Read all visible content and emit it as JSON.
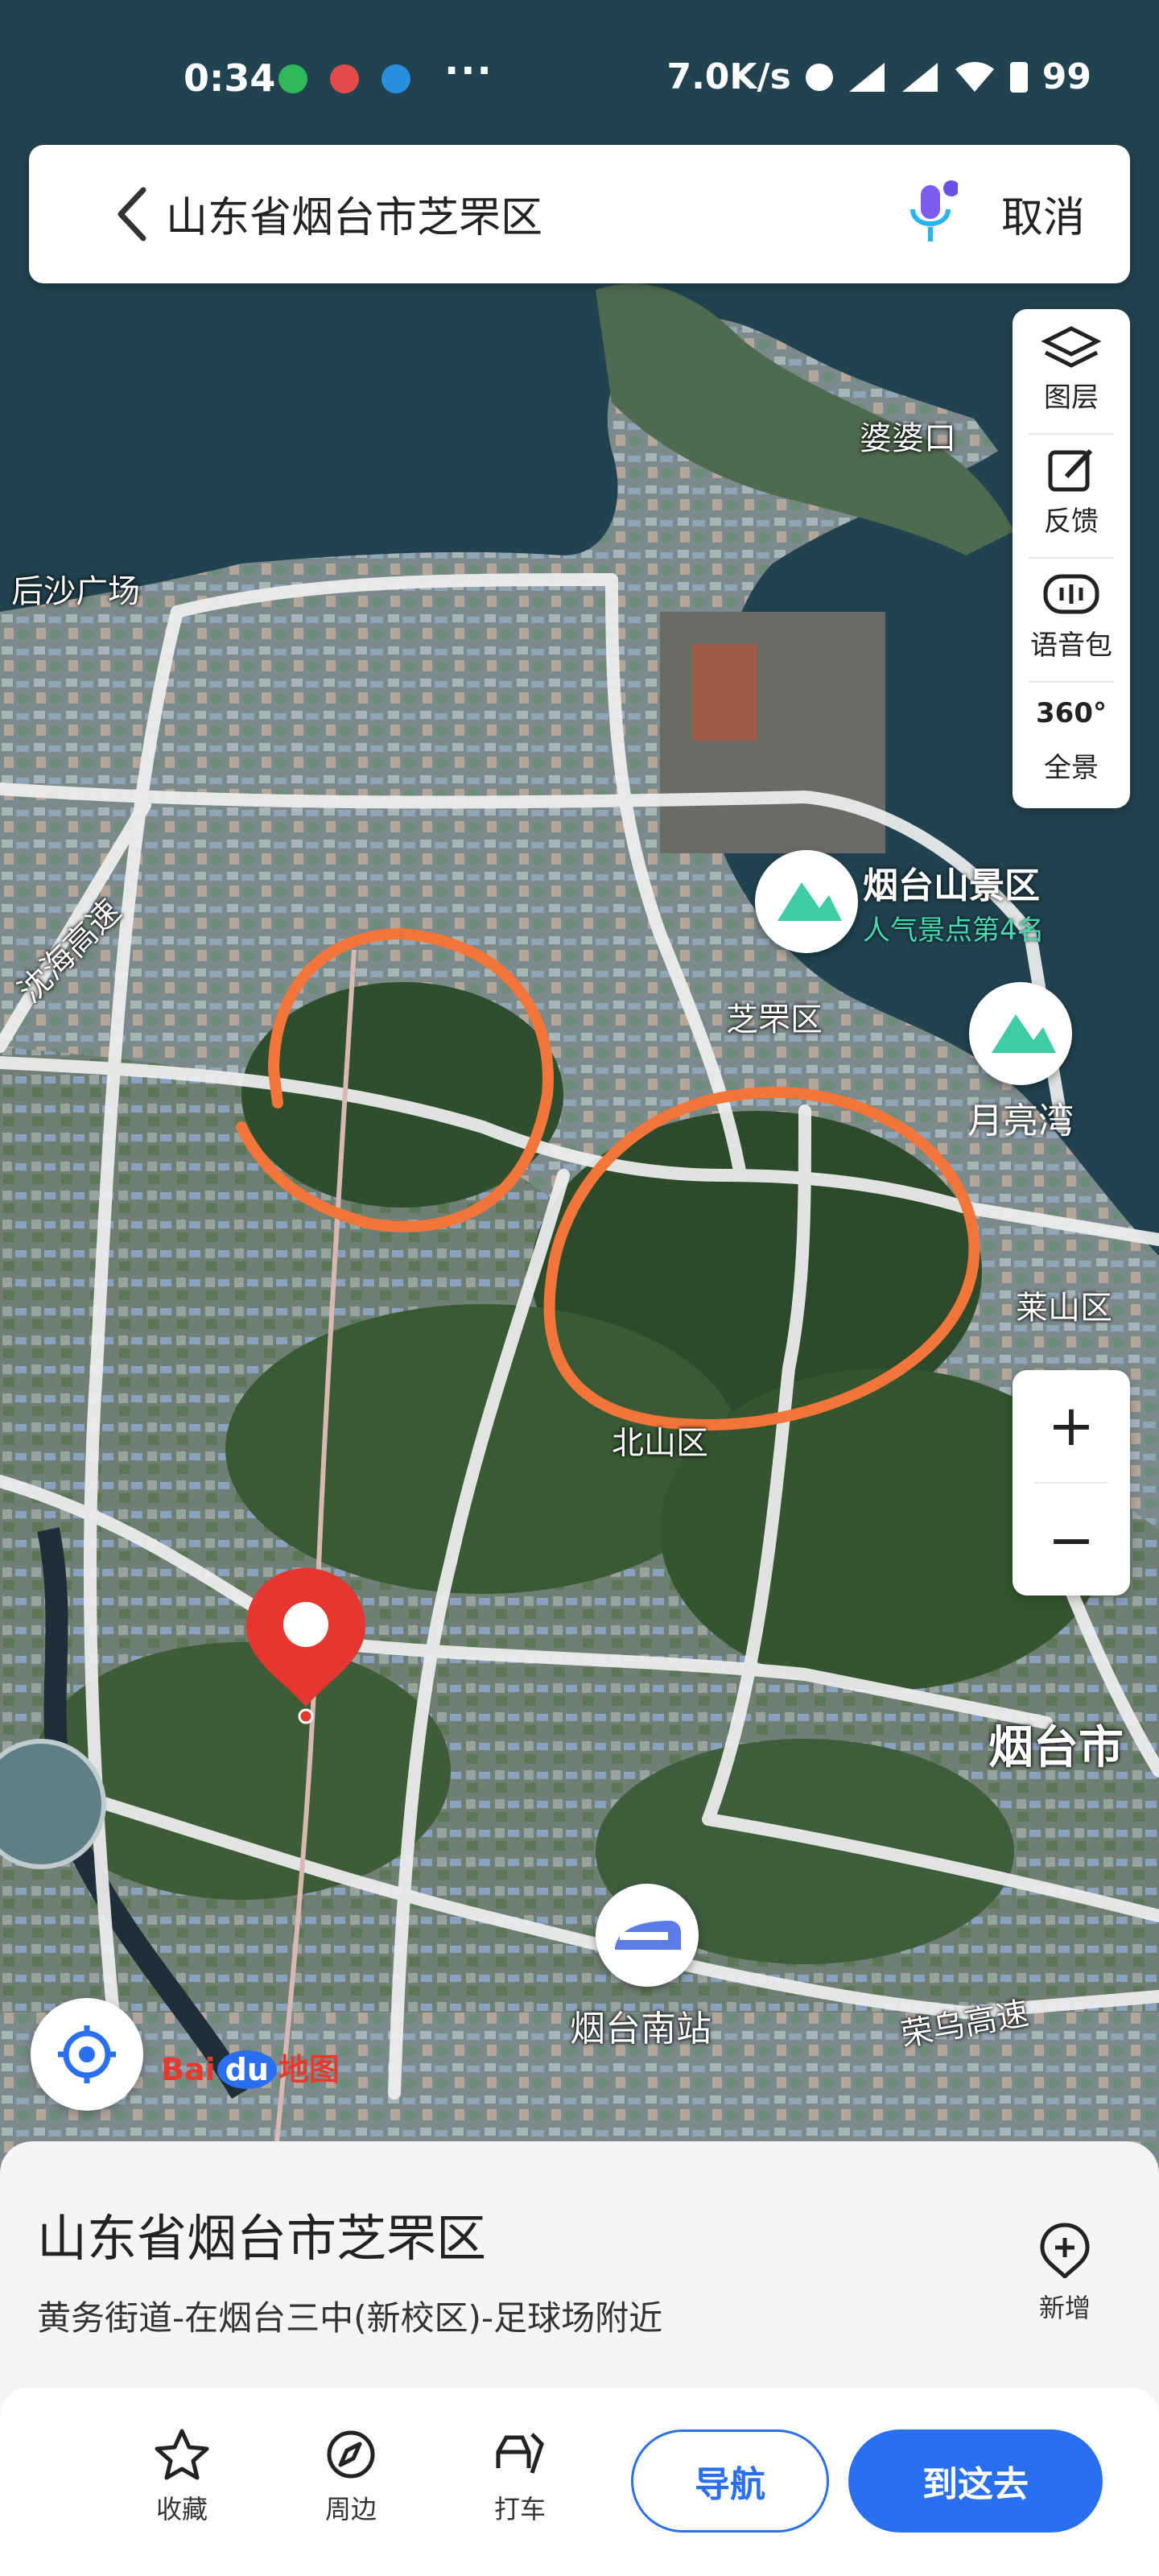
{
  "status_bar": {
    "time": "0:34",
    "net_speed": "7.0K/s",
    "battery": "99"
  },
  "search": {
    "title": "山东省烟台市芝罘区",
    "cancel_label": "取消"
  },
  "tools": {
    "layers_label": "图层",
    "feedback_label": "反馈",
    "voice_label": "语音包",
    "panorama_label": "全景",
    "panorama_badge": "360°"
  },
  "map_labels": {
    "pokou": "婆婆口",
    "houshan": "后沙广场",
    "zhifu": "芝罘区",
    "laishan": "莱山区",
    "yantai_city": "烟台市",
    "yantai_south": "烟台南站",
    "rongwu": "荣乌高速",
    "hai_expressway": "沈海高速",
    "beishan": "北山区"
  },
  "pois": {
    "scenic_title": "烟台山景区",
    "scenic_sub": "人气景点第4名",
    "moon_bay": "月亮湾"
  },
  "logo": {
    "bai": "Bai",
    "du": "du",
    "ditu": "地图"
  },
  "card": {
    "title": "山东省烟台市芝罘区",
    "address": "黄务街道-在烟台三中(新校区)-足球场附近",
    "add_label": "新增"
  },
  "bottom_bar": {
    "collect_label": "收藏",
    "nearby_label": "周边",
    "taxi_label": "打车",
    "navigate_label": "导航",
    "go_label": "到这去"
  },
  "colors": {
    "accent": "#2a6ff0",
    "road": "#f2f2f2",
    "annotation": "#f2753a",
    "pin": "#e5362f"
  }
}
